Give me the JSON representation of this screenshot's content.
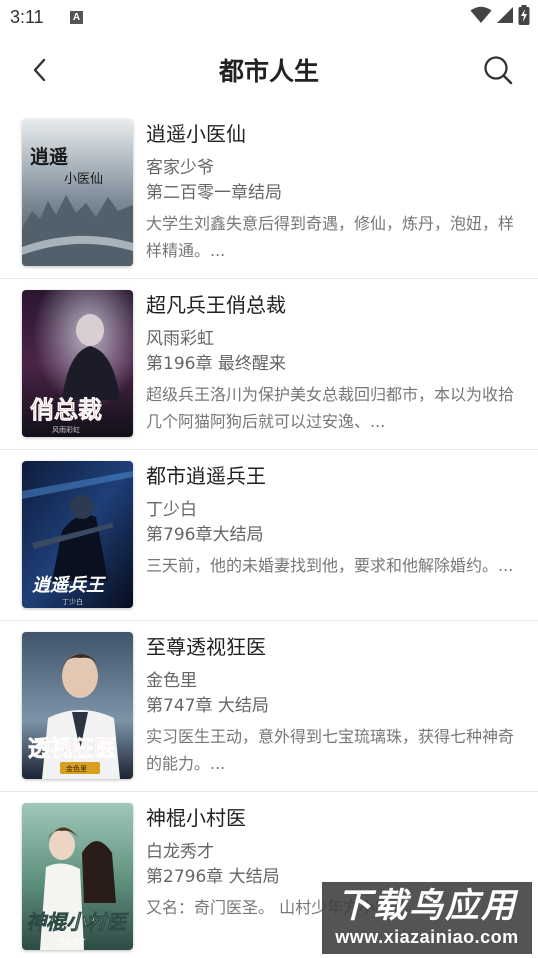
{
  "status_bar": {
    "time": "3:11",
    "notification_letter": "A"
  },
  "header": {
    "title": "都市人生"
  },
  "books": [
    {
      "title": "逍遥小医仙",
      "author": "客家少爷",
      "chapter": "第二百零一章结局",
      "description": "大学生刘鑫失意后得到奇遇，修仙，炼丹，泡妞，样样精通。...",
      "cover_text": "逍遥小医仙",
      "cover_colors": [
        "#e8ecef",
        "#7e8c98",
        "#3e4a55"
      ]
    },
    {
      "title": "超凡兵王俏总裁",
      "author": "风雨彩虹",
      "chapter": "第196章 最终醒来",
      "description": "超级兵王洛川为保护美女总裁回归都市，本以为收拾几个阿猫阿狗后就可以过安逸、...",
      "cover_text": "俏总裁",
      "cover_colors": [
        "#2a1630",
        "#4b2447",
        "#101018"
      ]
    },
    {
      "title": "都市逍遥兵王",
      "author": "丁少白",
      "chapter": "第796章大结局",
      "description": "三天前，他的未婚妻找到他，要求和他解除婚约。...",
      "cover_text": "逍遥兵王",
      "cover_colors": [
        "#0e1c3c",
        "#1f3f78",
        "#070c1c"
      ]
    },
    {
      "title": "至尊透视狂医",
      "author": "金色里",
      "chapter": "第747章 大结局",
      "description": "实习医生王动，意外得到七宝琉璃珠，获得七种神奇的能力。...",
      "cover_text": "透视狂医",
      "cover_colors": [
        "#40546a",
        "#7d94a8",
        "#1c2432"
      ]
    },
    {
      "title": "神棍小村医",
      "author": "白龙秀才",
      "chapter": "第2796章 大结局",
      "description": "又名：奇门医圣。 山村少年方小宇，",
      "cover_text": "神棍小村医",
      "cover_colors": [
        "#9fc8b8",
        "#5d8e7c",
        "#2d4a44"
      ]
    }
  ],
  "watermark": {
    "top": "下载鸟应用",
    "bottom": "www.xiazainiao.com"
  }
}
